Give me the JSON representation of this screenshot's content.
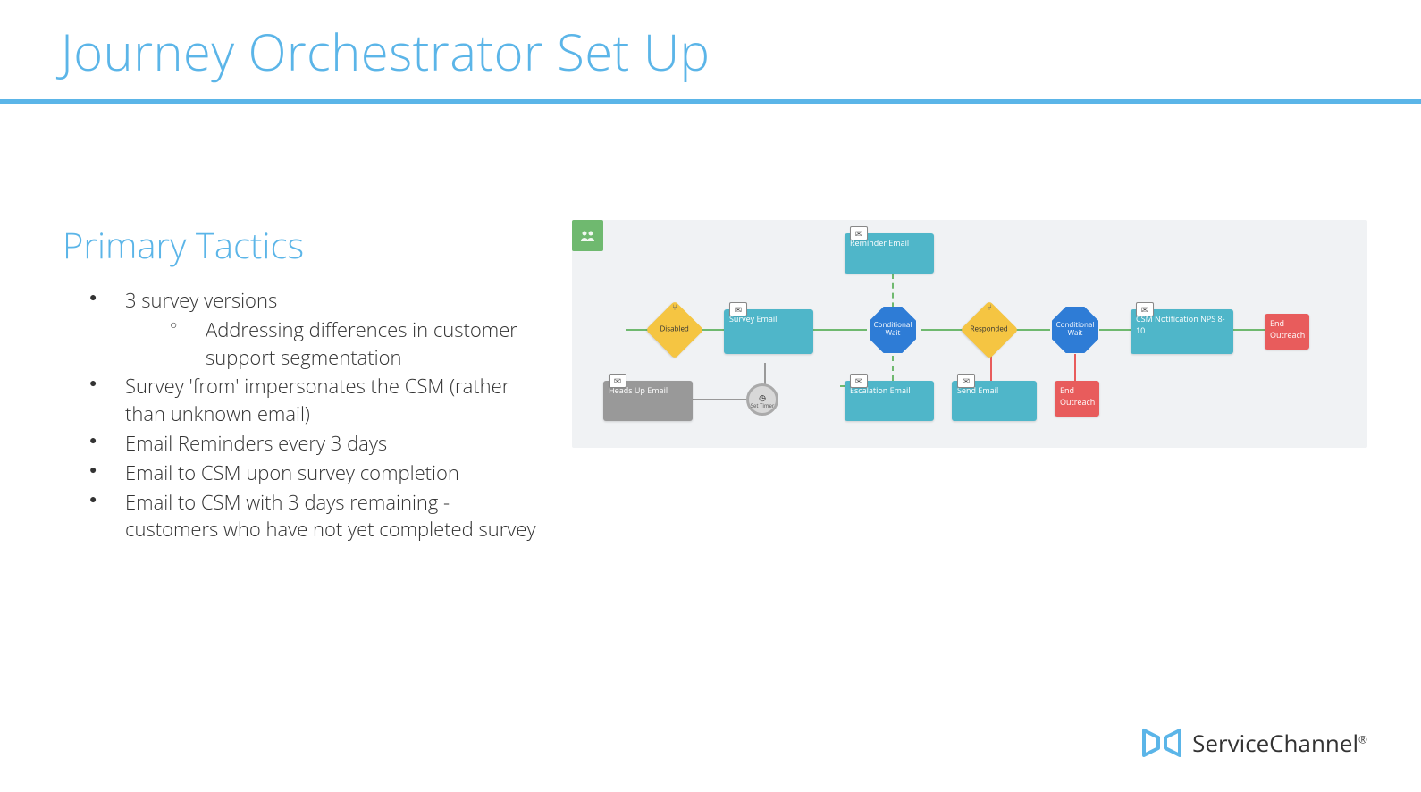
{
  "slide": {
    "title": "Journey Orchestrator Set Up",
    "section_heading": "Primary Tactics",
    "bullets": [
      {
        "text": "3 survey versions",
        "sub": [
          "Addressing differences in customer support segmentation"
        ]
      },
      {
        "text": "Survey 'from' impersonates the CSM (rather than unknown email)"
      },
      {
        "text": "Email Reminders every 3 days"
      },
      {
        "text": "Email to CSM upon survey completion"
      },
      {
        "text": "Email to CSM with 3 days remaining - customers who have not yet completed survey"
      }
    ]
  },
  "diagram": {
    "nodes": {
      "start": "",
      "disabled": "Disabled",
      "survey_email": "Survey Email",
      "heads_up_email": "Heads Up Email",
      "set_timer": "Set Timer",
      "reminder_email": "Reminder Email",
      "conditional_wait_1": "Conditional Wait",
      "escalation_email": "Escalation Email",
      "responded": "Responded",
      "send_email": "Send Email",
      "conditional_wait_2": "Conditional Wait",
      "end_outreach_1": "End Outreach",
      "csm_notification": "CSM Notification NPS 8-10",
      "end_outreach_2": "End Outreach"
    }
  },
  "footer": {
    "brand": "ServiceChannel"
  },
  "colors": {
    "accent": "#5bb5e8",
    "teal": "#4fb6c9",
    "yellow": "#f5c542",
    "blue": "#2e7cd6",
    "red": "#e85c5c",
    "green": "#6fb96f",
    "gray": "#999"
  }
}
